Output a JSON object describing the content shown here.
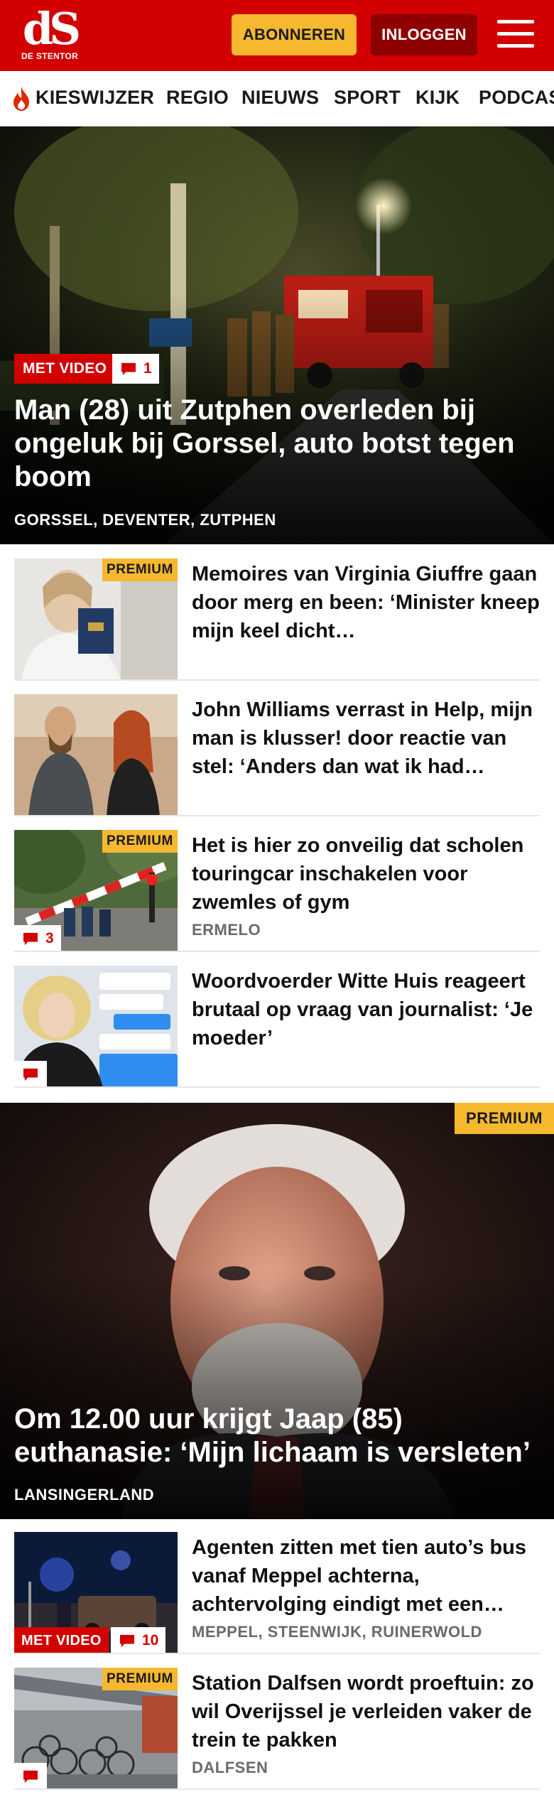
{
  "header": {
    "logo_mark": "dS",
    "logo_sub": "DE STENTOR",
    "subscribe_label": "ABONNEREN",
    "login_label": "INLOGGEN",
    "brand_color": "#d30000",
    "accent_color": "#f5b82e"
  },
  "nav": {
    "items": [
      "KIESWIJZER",
      "REGIO",
      "NIEUWS",
      "SPORT",
      "KIJK",
      "PODCAST"
    ]
  },
  "hero1": {
    "badge": "MET VIDEO",
    "comments": "1",
    "title": "Man (28) uit Zutphen overleden bij ongeluk bij Gorssel, auto botst tegen boom",
    "tags": "GORSSEL, DEVENTER, ZUTPHEN"
  },
  "articles": [
    {
      "title": "Memoires van Virginia Giuffre gaan door merg en been: ‘Minister kneep mijn keel dicht…",
      "premium": "PREMIUM"
    },
    {
      "title": "John Williams verrast in Help, mijn man is klusser! door reactie van stel: ‘Anders dan wat ik had…"
    },
    {
      "title": "Het is hier zo onveilig dat scholen touringcar inschakelen voor zwemles of gym",
      "premium": "PREMIUM",
      "location": "ERMELO",
      "comments": "3"
    },
    {
      "title": "Woordvoerder Witte Huis reageert brutaal op vraag van journalist: ‘Je moeder’"
    }
  ],
  "hero2": {
    "premium": "PREMIUM",
    "title": "Om 12.00 uur krijgt Jaap (85) euthanasie: ‘Mijn lichaam is versleten’",
    "tags": "LANSINGERLAND"
  },
  "articles2": [
    {
      "title": "Agenten zitten met tien auto’s bus vanaf Meppel achterna, achtervolging eindigt met een…",
      "badge": "MET VIDEO",
      "comments": "10",
      "location": "MEPPEL, STEENWIJK, RUINERWOLD"
    },
    {
      "title": "Station Dalfsen wordt proeftuin: zo wil Overijssel je verleiden vaker de trein te pakken",
      "premium": "PREMIUM",
      "location": "DALFSEN"
    }
  ]
}
